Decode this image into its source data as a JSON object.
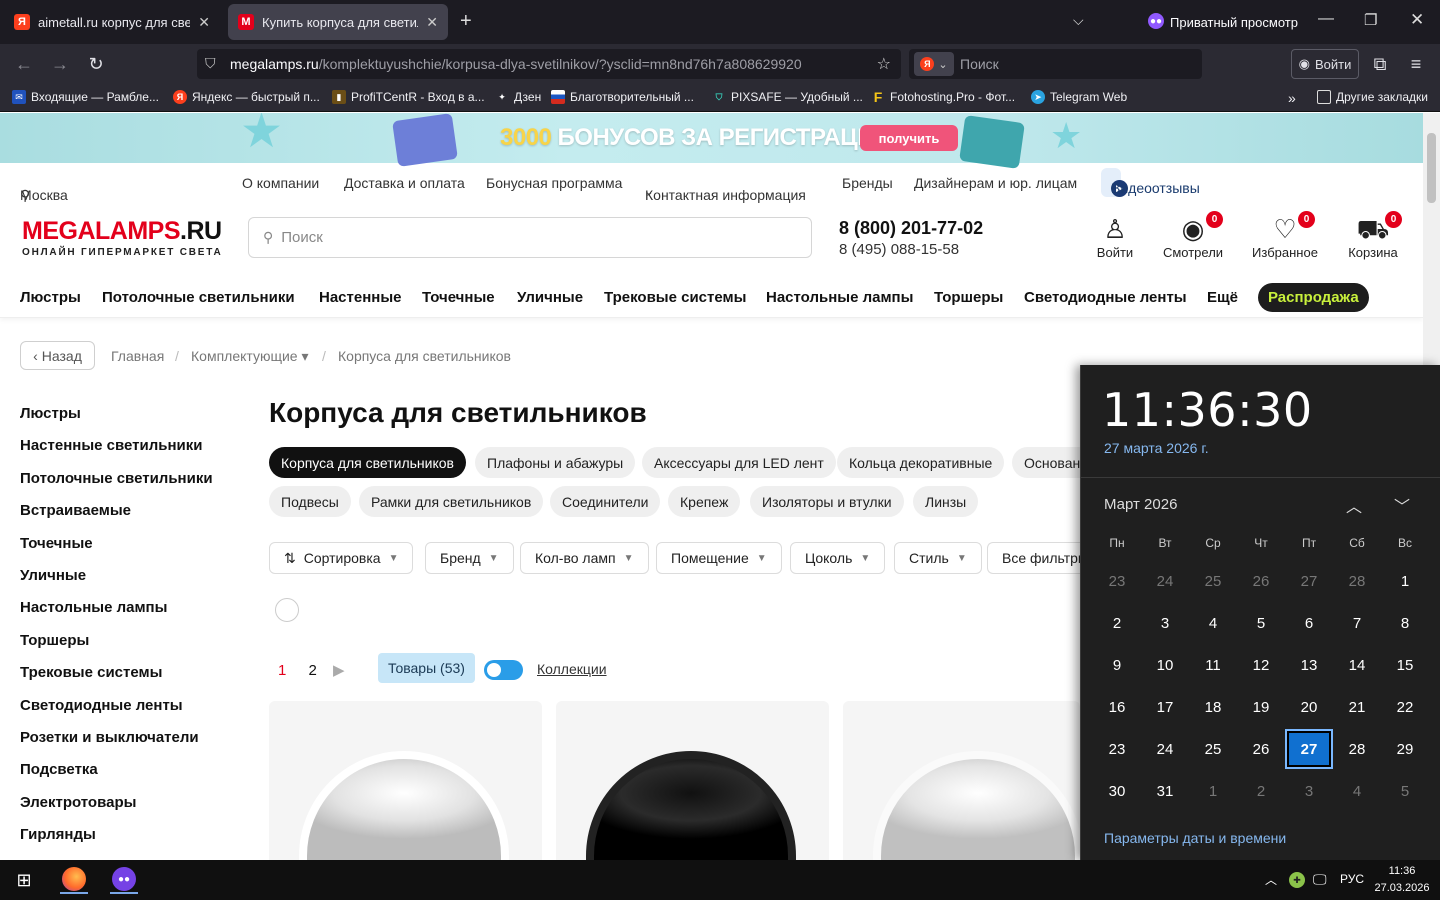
{
  "browser": {
    "tabs": [
      {
        "title": "aimetall.ru корпус для светоди",
        "favicon": "Я"
      },
      {
        "title": "Купить корпуса для светильни",
        "favicon": "M"
      }
    ],
    "private_label": "Приватный просмотр",
    "url_domain": "megalamps.ru",
    "url_path": "/komplektuyushchie/korpusa-dlya-svetilnikov/?ysclid=mn8nd76h7a808629920",
    "search_placeholder": "Поиск",
    "login": "Войти",
    "bookmarks": [
      "Входящие — Рамбле...",
      "Яндекс — быстрый п...",
      "ProfiTCentR - Вход в а...",
      "Дзен",
      "Благотворительный ...",
      "PIXSAFE — Удобный ...",
      "Fotohosting.Pro - Фот...",
      "Telegram Web",
      "Другие закладки"
    ]
  },
  "banner": {
    "highlight": "3000",
    "text": " БОНУСОВ ЗА РЕГИСТРАЦИЮ",
    "button": "получить"
  },
  "topnav": {
    "city": "Москва",
    "links": [
      "О компании",
      "Доставка и оплата",
      "Бонусная программа",
      "Контактная информация",
      "Бренды",
      "Дизайнерам и юр. лицам"
    ],
    "video": "Видеоотзывы"
  },
  "header": {
    "logo_main": "MEGALAMPS",
    "logo_ext": ".RU",
    "logo_sub": "ОНЛАЙН ГИПЕРМАРКЕТ СВЕТА",
    "search_placeholder": "Поиск",
    "phone1": "8 (800) 201-77-02",
    "phone2": "8 (495) 088-15-58",
    "icons": [
      {
        "label": "Войти"
      },
      {
        "label": "Смотрели",
        "count": "0"
      },
      {
        "label": "Избранное",
        "count": "0"
      },
      {
        "label": "Корзина",
        "count": "0"
      }
    ]
  },
  "catnav": [
    "Люстры",
    "Потолочные светильники",
    "Настенные",
    "Точечные",
    "Уличные",
    "Трековые системы",
    "Настольные лампы",
    "Торшеры",
    "Светодиодные ленты",
    "Ещё"
  ],
  "sale": "Распродажа",
  "breadcrumbs": {
    "back": "Назад",
    "items": [
      "Главная",
      "Комплектующие ▾",
      "Корпуса для светильников"
    ]
  },
  "sidebar": [
    "Люстры",
    "Настенные светильники",
    "Потолочные светильники",
    "Встраиваемые",
    "Точечные",
    "Уличные",
    "Настольные лампы",
    "Торшеры",
    "Трековые системы",
    "Светодиодные ленты",
    "Розетки и выключатели",
    "Подсветка",
    "Электротовары",
    "Гирлянды"
  ],
  "page_title": "Корпуса для светильников",
  "chips_row1": [
    "Корпуса для светильников",
    "Плафоны и абажуры",
    "Аксессуары для LED лент",
    "Кольца декоративные",
    "Основан"
  ],
  "chips_row2": [
    "Подвесы",
    "Рамки для светильников",
    "Соединители",
    "Крепеж",
    "Изоляторы и втулки",
    "Линзы"
  ],
  "filters": [
    "Сортировка",
    "Бренд",
    "Кол-во ламп",
    "Помещение",
    "Цоколь",
    "Стиль",
    "Все фильтры"
  ],
  "colors": [
    "#ffffff",
    "#000000",
    "#c8c8c8"
  ],
  "pager": {
    "p1": "1",
    "p2": "2"
  },
  "products_tab": "Товары (53)",
  "collections": "Коллекции",
  "calendar": {
    "time": "11:36:30",
    "date": "27 марта 2026 г.",
    "month": "Март 2026",
    "weekdays": [
      "Пн",
      "Вт",
      "Ср",
      "Чт",
      "Пт",
      "Сб",
      "Вс"
    ],
    "days": [
      "23",
      "24",
      "25",
      "26",
      "27",
      "28",
      "1",
      "2",
      "3",
      "4",
      "5",
      "6",
      "7",
      "8",
      "9",
      "10",
      "11",
      "12",
      "13",
      "14",
      "15",
      "16",
      "17",
      "18",
      "19",
      "20",
      "21",
      "22",
      "23",
      "24",
      "25",
      "26",
      "27",
      "28",
      "29",
      "30",
      "31",
      "1",
      "2",
      "3",
      "4",
      "5"
    ],
    "today_index": 32,
    "settings": "Параметры даты и времени"
  },
  "taskbar": {
    "lang": "РУС",
    "time": "11:36",
    "date": "27.03.2026"
  }
}
